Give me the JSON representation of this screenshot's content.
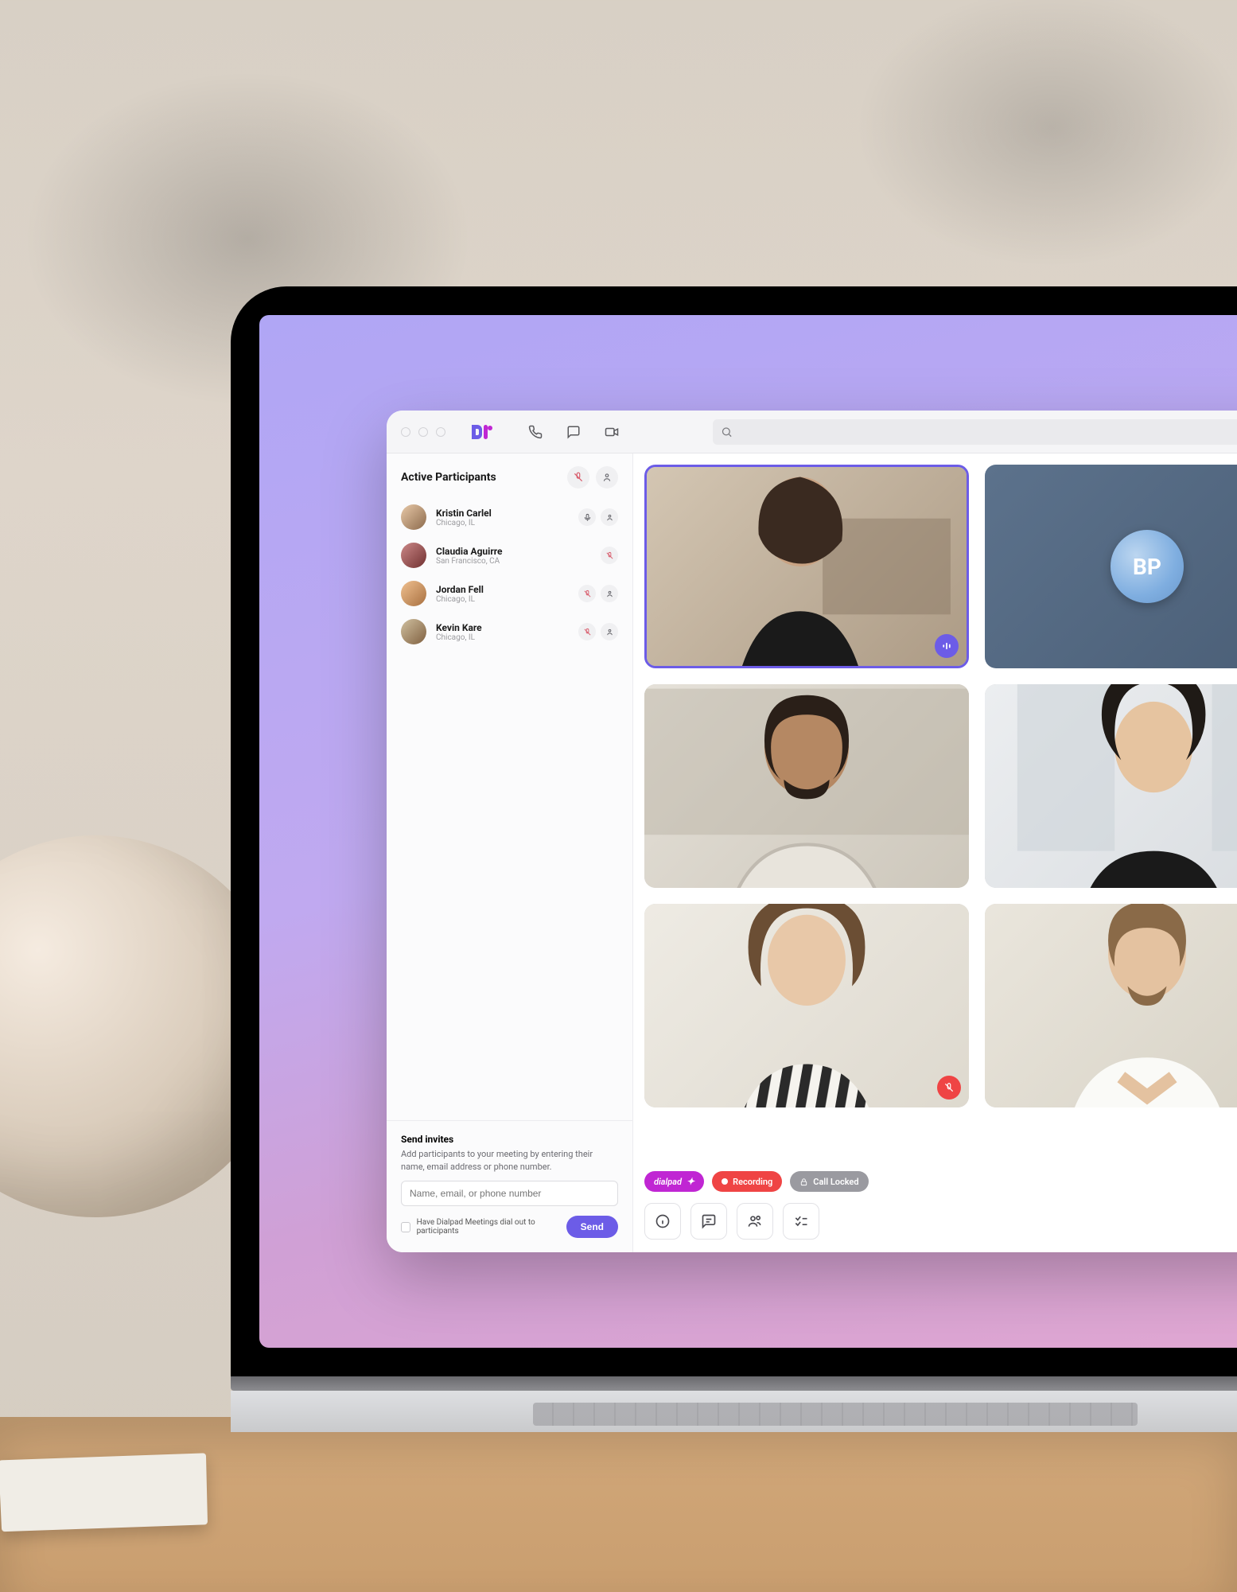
{
  "brand": {
    "name": "dialpad"
  },
  "search": {
    "placeholder": ""
  },
  "sidebar": {
    "title": "Active Participants",
    "participants": [
      {
        "name": "Kristin Carlel",
        "location": "Chicago, IL",
        "mic": "on"
      },
      {
        "name": "Claudia Aguirre",
        "location": "San Francisco, CA",
        "mic": "muted"
      },
      {
        "name": "Jordan Fell",
        "location": "Chicago, IL",
        "mic": "muted"
      },
      {
        "name": "Kevin Kare",
        "location": "Chicago, IL",
        "mic": "muted"
      }
    ]
  },
  "invites": {
    "title": "Send invites",
    "description": "Add participants to your meeting by entering their name, email address or phone number.",
    "placeholder": "Name, email, or phone number",
    "checkbox_label": "Have Dialpad Meetings dial out to participants",
    "send_label": "Send"
  },
  "status": {
    "brand_label": "dialpad",
    "recording_label": "Recording",
    "lock_label": "Call Locked"
  },
  "tiles": {
    "initials": "BP"
  },
  "colors": {
    "accent": "#6c5ce7",
    "brand_pink": "#c026d3",
    "danger": "#ef4444"
  }
}
